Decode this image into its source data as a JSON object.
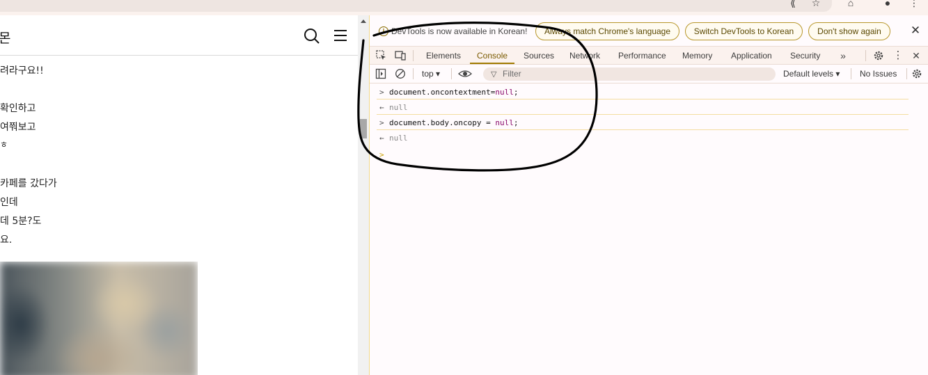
{
  "page": {
    "title": "몬",
    "lines": [
      "려라구요!!",
      "확인하고",
      "여쭤보고",
      "ㅎ",
      "카페를 갔다가",
      "인데",
      "데 5분?도",
      "요."
    ]
  },
  "devtools": {
    "infobar": {
      "message": "DevTools is now available in Korean!",
      "buttons": [
        "Always match Chrome's language",
        "Switch DevTools to Korean",
        "Don't show again"
      ]
    },
    "tabs": [
      "Elements",
      "Console",
      "Sources",
      "Network",
      "Performance",
      "Memory",
      "Application",
      "Security"
    ],
    "active_tab": "Console",
    "toolbar": {
      "context": "top ▾",
      "filter_placeholder": "Filter",
      "levels": "Default levels ▾",
      "issues": "No Issues"
    },
    "console": {
      "entries": [
        {
          "type": "input",
          "prefix": ">",
          "code": "document.oncontextment=",
          "keyword": "null",
          "suffix": ";"
        },
        {
          "type": "result",
          "prefix": "←",
          "value": "null"
        },
        {
          "type": "input",
          "prefix": ">",
          "code": "document.body.oncopy = ",
          "keyword": "null",
          "suffix": ";"
        },
        {
          "type": "result",
          "prefix": "←",
          "value": "null"
        }
      ],
      "prompt": ">"
    }
  },
  "colors": {
    "accent": "#a07a00",
    "keyword": "#8a0a6b",
    "annotation": "#000000"
  }
}
